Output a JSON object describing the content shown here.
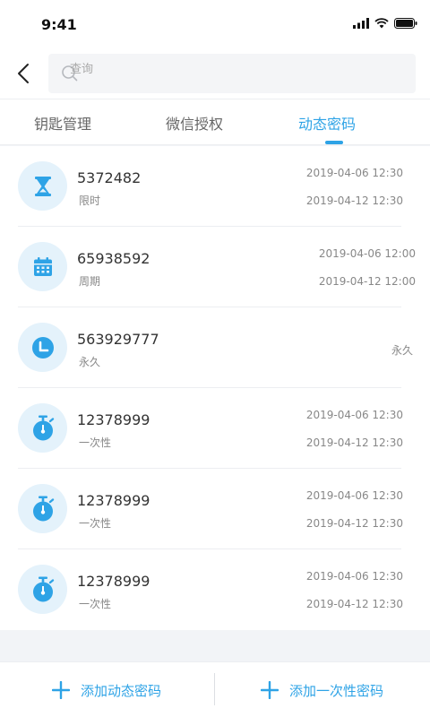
{
  "status": {
    "time": "9:41"
  },
  "search": {
    "placeholder": "查询"
  },
  "tabs": [
    {
      "label": "钥匙管理",
      "active": false
    },
    {
      "label": "微信授权",
      "active": false
    },
    {
      "label": "动态密码",
      "active": true
    }
  ],
  "rows": [
    {
      "code": "5372482",
      "type": "限时",
      "icon": "hourglass-icon",
      "start": "2019-04-06 12:30",
      "end": "2019-04-12 12:30"
    },
    {
      "code": "65938592",
      "type": "周期",
      "icon": "calendar-icon",
      "start": "2019-04-06 12:00",
      "end": "2019-04-12 12:00"
    },
    {
      "code": "563929777",
      "type": "永久",
      "icon": "clock-icon",
      "note": "永久"
    },
    {
      "code": "12378999",
      "type": "一次性",
      "icon": "stopwatch-icon",
      "start": "2019-04-06 12:30",
      "end": "2019-04-12 12:30"
    },
    {
      "code": "12378999",
      "type": "一次性",
      "icon": "stopwatch-icon",
      "start": "2019-04-06 12:30",
      "end": "2019-04-12 12:30"
    },
    {
      "code": "12378999",
      "type": "一次性",
      "icon": "stopwatch-icon",
      "start": "2019-04-06 12:30",
      "end": "2019-04-12 12:30"
    }
  ],
  "actions": {
    "add_dynamic": "添加动态密码",
    "add_once": "添加一次性密码"
  },
  "colors": {
    "accent": "#2ea3e6",
    "icon_bg": "#e4f2fb"
  }
}
